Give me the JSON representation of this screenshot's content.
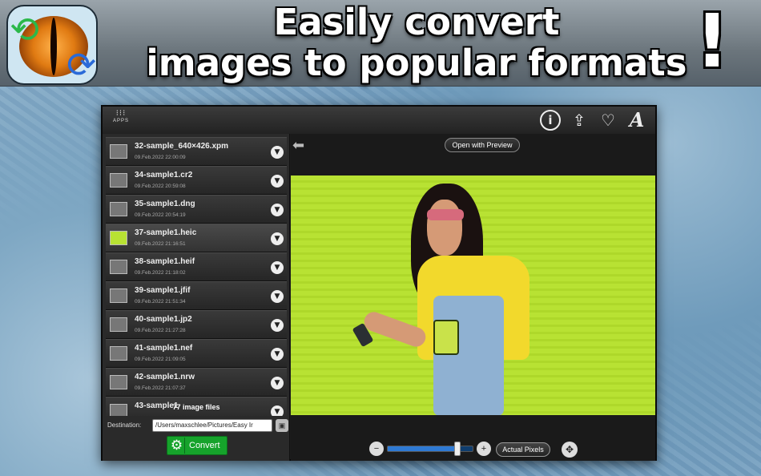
{
  "headline": {
    "line1": "Easily convert",
    "line2": "images to popular formats",
    "exclaim": "!"
  },
  "toolbar": {
    "apps_label": "APPS",
    "apps_glyph": "⁝⁝⁝",
    "icons": [
      "info-icon",
      "share-icon",
      "heart-icon",
      "font-icon"
    ]
  },
  "files": [
    {
      "name": "32-sample_640×426.xpm",
      "date": "09.Feb.2022 22:00:09"
    },
    {
      "name": "34-sample1.cr2",
      "date": "09.Feb.2022 20:59:08"
    },
    {
      "name": "35-sample1.dng",
      "date": "09.Feb.2022 20:54:19"
    },
    {
      "name": "37-sample1.heic",
      "date": "09.Feb.2022 21:16:51"
    },
    {
      "name": "38-sample1.heif",
      "date": "09.Feb.2022 21:18:02"
    },
    {
      "name": "39-sample1.jfif",
      "date": "09.Feb.2022 21:51:34"
    },
    {
      "name": "40-sample1.jp2",
      "date": "09.Feb.2022 21:27:28"
    },
    {
      "name": "41-sample1.nef",
      "date": "09.Feb.2022 21:09:05"
    },
    {
      "name": "42-sample1.nrw",
      "date": "09.Feb.2022 21:07:37"
    },
    {
      "name": "43-sample1",
      "date": ""
    }
  ],
  "selected_index": 3,
  "file_count": "77 image files",
  "destination": {
    "label": "Destination:",
    "path": "/Users/maxschlee/Pictures/Easy Ir"
  },
  "convert_label": "Convert",
  "preview": {
    "open_label": "Open with Preview",
    "actual_label": "Actual Pixels",
    "zoom_level": 0.82
  },
  "colors": {
    "convert_green": "#16a32b",
    "slider_blue": "#2f7ad4",
    "photo_bg": "#b8e233"
  }
}
